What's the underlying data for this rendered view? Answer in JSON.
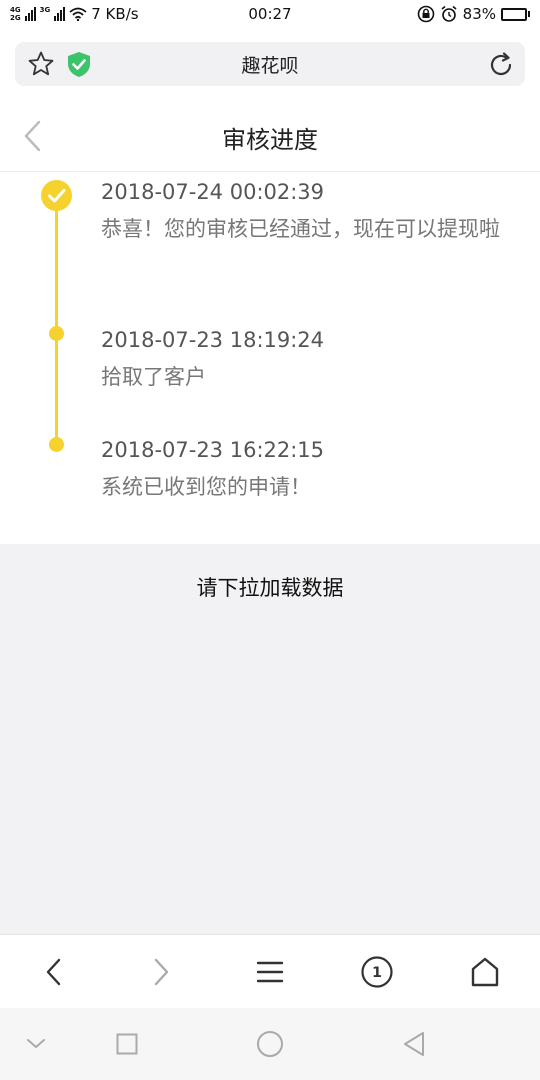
{
  "status_bar": {
    "net_type_top": "4G",
    "net_type_bottom": "2G",
    "net_type_2": "3G",
    "speed": "7 KB/s",
    "time": "00:27",
    "battery": "83%",
    "battery_level": 0.83
  },
  "address_bar": {
    "title": "趣花呗",
    "icons": [
      "star-icon",
      "shield-check-icon",
      "refresh-icon"
    ]
  },
  "header": {
    "title": "审核进度",
    "back_icon": "chevron-left-icon"
  },
  "timeline": {
    "accent_color": "#f5d22e",
    "entries": [
      {
        "time": "2018-07-24 00:02:39",
        "message": "恭喜！您的审核已经通过，现在可以提现啦"
      },
      {
        "time": "2018-07-23 18:19:24",
        "message": "拾取了客户"
      },
      {
        "time": "2018-07-23 16:22:15",
        "message": "系统已收到您的申请！"
      }
    ]
  },
  "content": {
    "pull_hint": "请下拉加载数据"
  },
  "toolbar": {
    "tab_count": "1",
    "icons": [
      "back-arrow-icon",
      "forward-arrow-icon",
      "menu-icon",
      "tabs-icon",
      "home-icon"
    ]
  },
  "system_nav": {
    "icons": [
      "chevron-down-icon",
      "recents-square-icon",
      "home-circle-icon",
      "back-triangle-icon"
    ]
  }
}
